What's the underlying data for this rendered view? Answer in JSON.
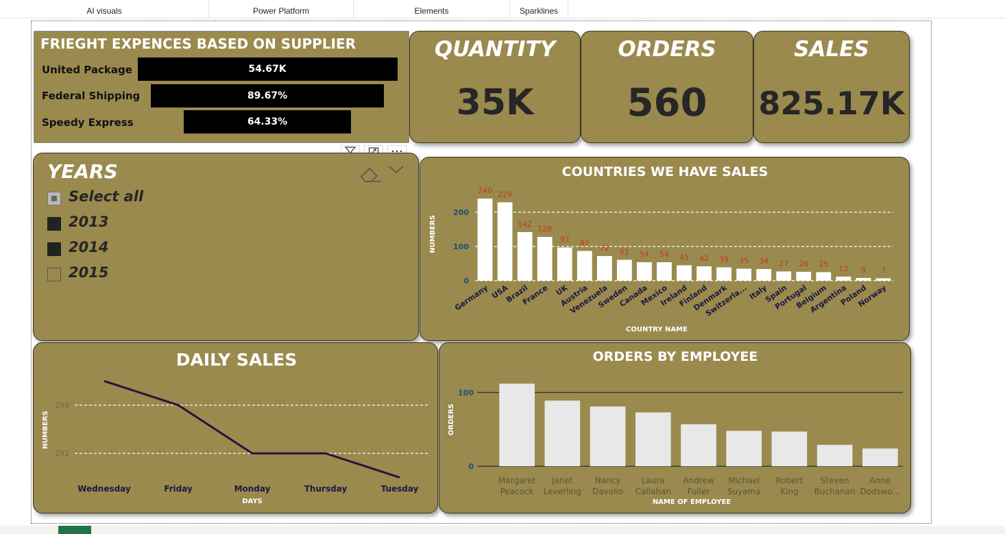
{
  "ribbon": {
    "tabs": [
      "AI visuals",
      "Power Platform",
      "Elements",
      "Sparklines"
    ]
  },
  "freight": {
    "title": "FRIEGHT EXPENCES BASED ON SUPPLIER",
    "rows": [
      {
        "label": "United Package",
        "value": "54.67K",
        "fill": 1.0
      },
      {
        "label": "Federal Shipping",
        "value": "89.67%",
        "fill": 0.8967
      },
      {
        "label": "Speedy Express",
        "value": "64.33%",
        "fill": 0.6433
      }
    ]
  },
  "kpis": {
    "quantity": {
      "title": "QUANTITY",
      "value": "35K"
    },
    "orders": {
      "title": "ORDERS",
      "value": "560"
    },
    "sales": {
      "title": "SALES",
      "value": "825.17K"
    }
  },
  "years": {
    "title": "YEARS",
    "items": [
      {
        "label": "Select all",
        "state": "partial"
      },
      {
        "label": "2013",
        "state": "checked"
      },
      {
        "label": "2014",
        "state": "checked"
      },
      {
        "label": "2015",
        "state": "unchecked"
      }
    ]
  },
  "icons": {
    "filter": "filter-icon",
    "focus": "focus-mode-icon",
    "more": "more-options-icon",
    "eraser": "eraser-icon",
    "chevron": "chevron-down-icon"
  },
  "colors": {
    "card_bg": "#9a8a4e",
    "bar_white": "#ffffff",
    "data_label": "#c0391e",
    "axis_blue": "#1f4e79",
    "line": "#3a0a3a",
    "employee_bar": "#e8e8e8"
  },
  "chart_data": [
    {
      "type": "bar",
      "title": "COUNTRIES WE HAVE SALES",
      "xlabel": "COUNTRY NAME",
      "ylabel": "NUMBERS",
      "ylim": [
        0,
        250
      ],
      "yticks": [
        0,
        100,
        200
      ],
      "grid": true,
      "categories": [
        "Germany",
        "USA",
        "Brazil",
        "France",
        "UK",
        "Austria",
        "Venezuela",
        "Sweden",
        "Canada",
        "Mexico",
        "Ireland",
        "Finland",
        "Denmark",
        "Switzerla...",
        "Italy",
        "Spain",
        "Portugal",
        "Belgium",
        "Argentina",
        "Poland",
        "Norway"
      ],
      "values": [
        240,
        229,
        142,
        128,
        97,
        87,
        72,
        61,
        54,
        54,
        45,
        42,
        39,
        35,
        34,
        27,
        26,
        25,
        12,
        8,
        7
      ]
    },
    {
      "type": "line",
      "title": "DAILY SALES",
      "xlabel": "DAYS",
      "ylabel": "NUMBERS",
      "ylim": [
        290.9,
        295.1
      ],
      "yticks": [
        292,
        294
      ],
      "grid": true,
      "categories": [
        "Wednesday",
        "Friday",
        "Monday",
        "Thursday",
        "Tuesday"
      ],
      "values": [
        295,
        294,
        292,
        292,
        291
      ]
    },
    {
      "type": "bar",
      "title": "ORDERS BY EMPLOYEE",
      "xlabel": "NAME OF EMPLOYEE",
      "ylabel": "ORDERS",
      "ylim": [
        0,
        130
      ],
      "yticks": [
        0,
        100
      ],
      "grid": true,
      "categories": [
        [
          "Margaret",
          "Peacock"
        ],
        [
          "Janet",
          "Leverling"
        ],
        [
          "Nancy",
          "Davolio"
        ],
        [
          "Laura",
          "Callahan"
        ],
        [
          "Andrew",
          "Fuller"
        ],
        [
          "Michael",
          "Suyama"
        ],
        [
          "Robert",
          "King"
        ],
        [
          "Steven",
          "Buchanan"
        ],
        [
          "Anne",
          "Dodswo..."
        ]
      ],
      "values": [
        112,
        89,
        81,
        73,
        57,
        48,
        47,
        29,
        24
      ]
    }
  ]
}
